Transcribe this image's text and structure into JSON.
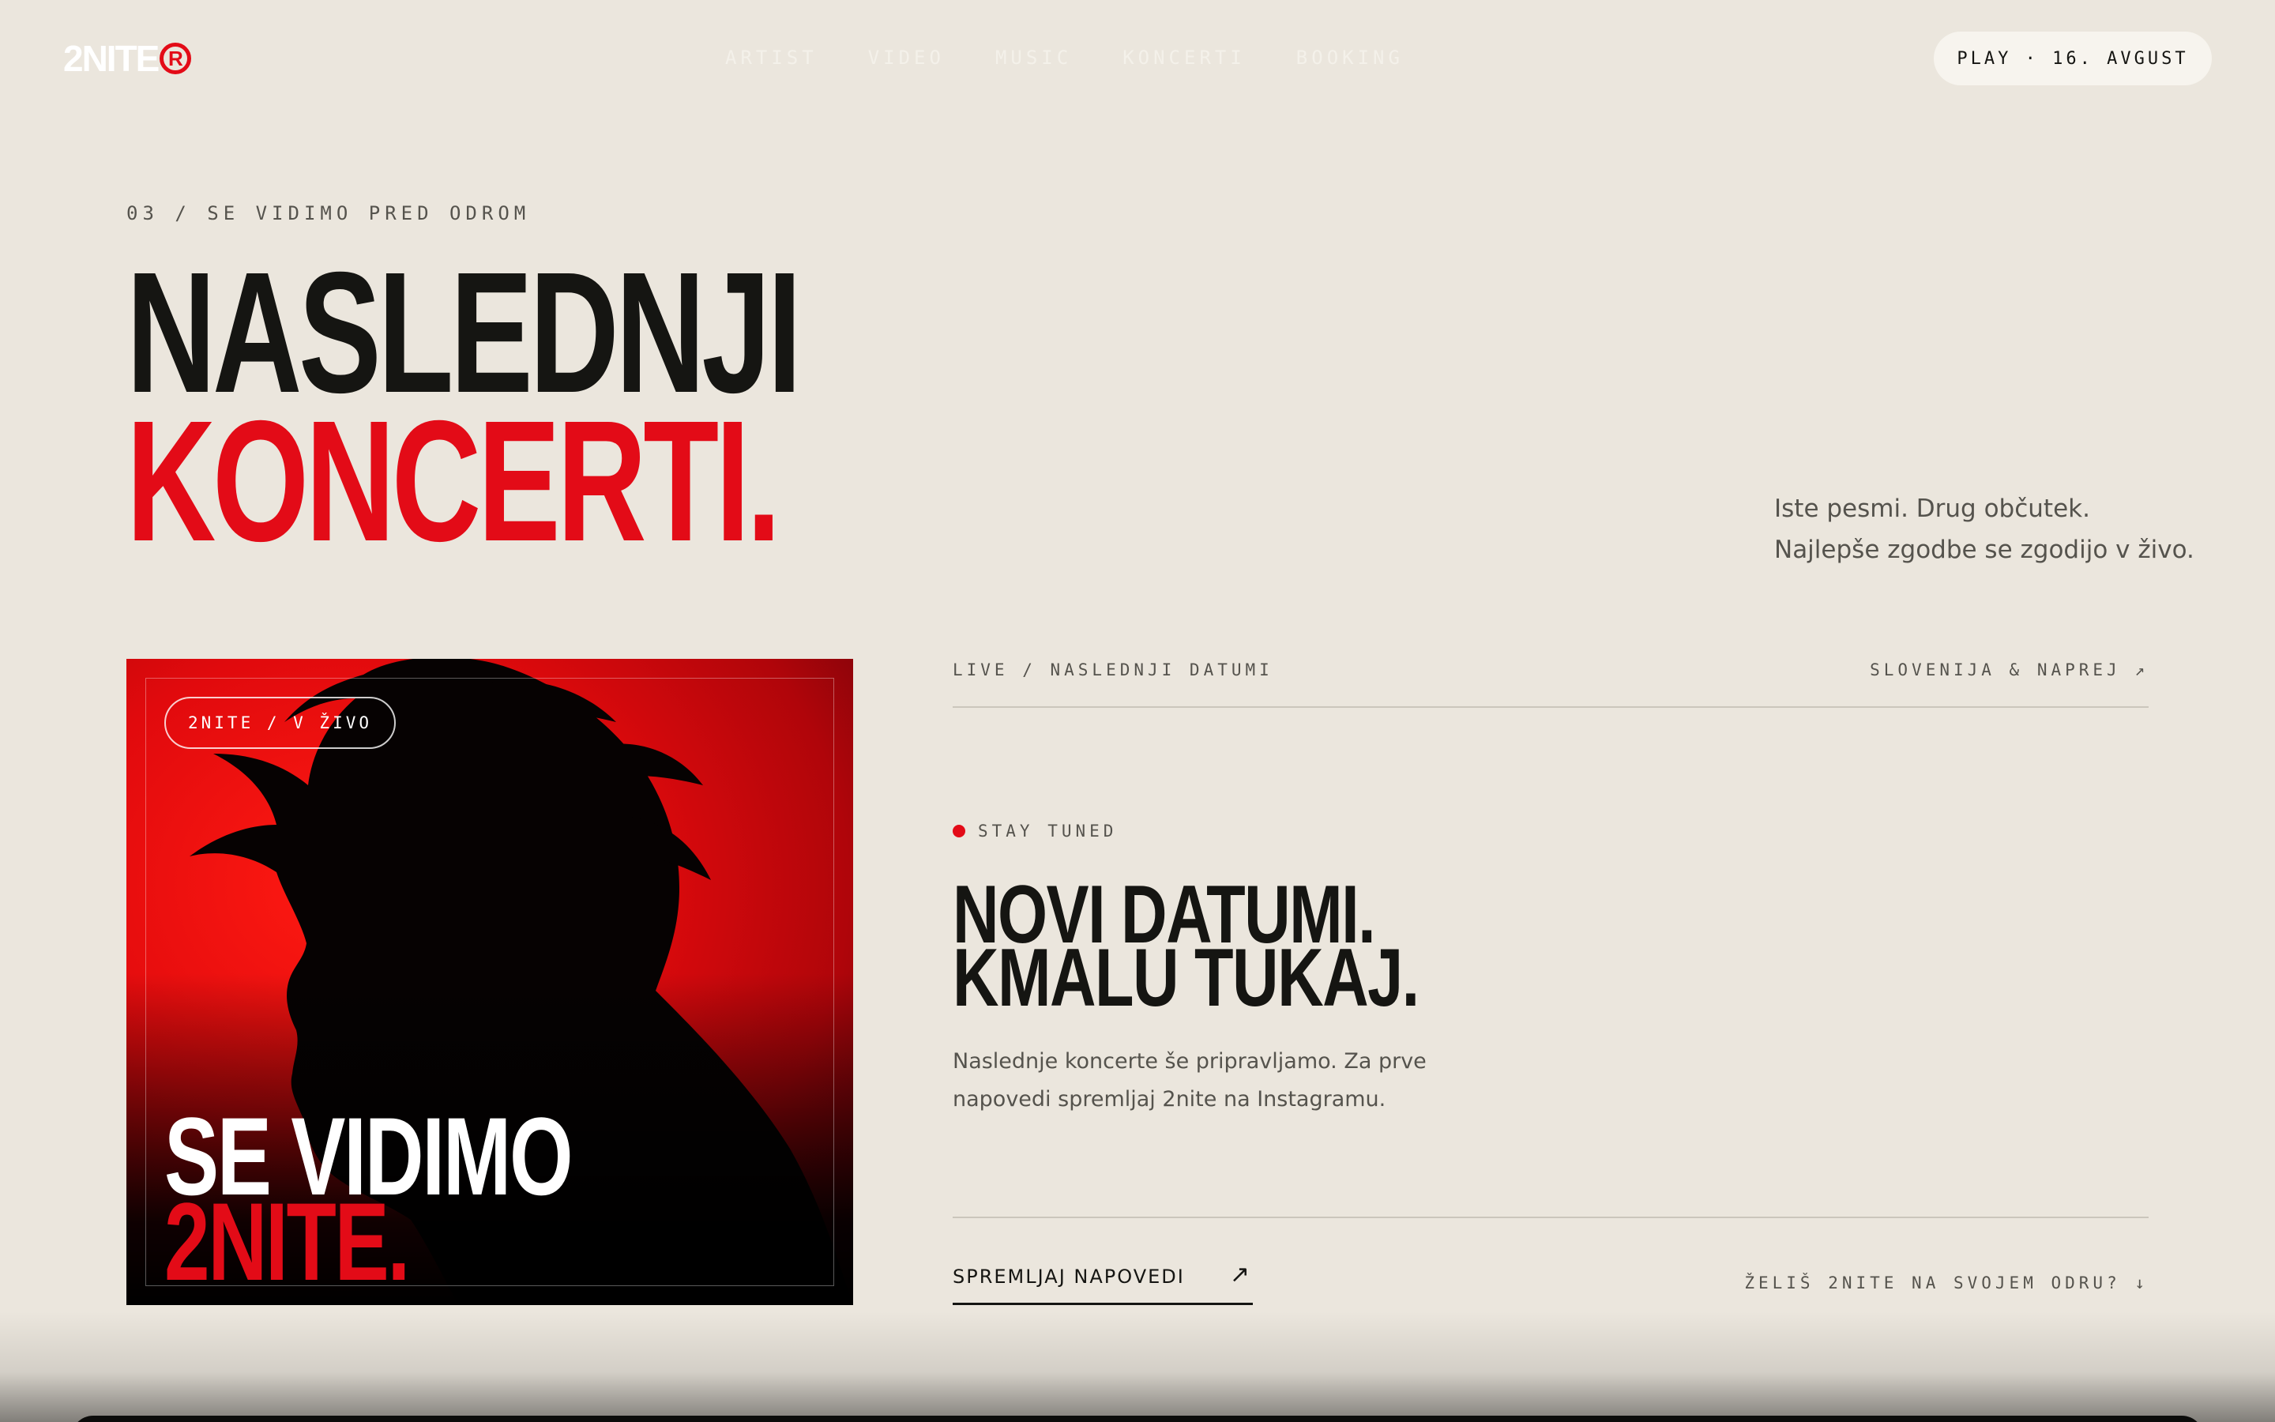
{
  "header": {
    "logo_text": "2NITE",
    "logo_mark": "R",
    "nav": [
      "ARTIST",
      "VIDEO",
      "MUSIC",
      "KONCERTI",
      "BOOKING"
    ],
    "play_button": "PLAY · 16. AVGUST"
  },
  "hero": {
    "eyebrow": "03 / SE VIDIMO PRED ODROM",
    "title_line1": "NASLEDNJI",
    "title_line2": "KONCERTI.",
    "tagline_line1": "Iste pesmi. Drug občutek.",
    "tagline_line2": "Najlepše zgodbe se zgodijo v živo."
  },
  "card": {
    "badge": "2NITE / V ŽIVO",
    "title_white": "SE VIDIMO",
    "title_red": "2NITE."
  },
  "live": {
    "label": "LIVE / NASLEDNJI DATUMI",
    "region": "SLOVENIJA & NAPREJ ↗",
    "status": "STAY TUNED",
    "headline_line1": "NOVI DATUMI.",
    "headline_line2": "KMALU TUKAJ.",
    "description": "Naslednje koncerte še pripravljamo. Za prve napovedi spremljaj 2nite na Instagramu.",
    "follow_label": "SPREMLJAJ NAPOVEDI",
    "follow_arrow": "↗",
    "booking_link": "ŽELIŠ 2NITE NA SVOJEM ODRU? ↓"
  },
  "colors": {
    "background": "#ebe6dd",
    "accent_red": "#e30b17",
    "ink": "#151512",
    "muted": "#55534d"
  }
}
